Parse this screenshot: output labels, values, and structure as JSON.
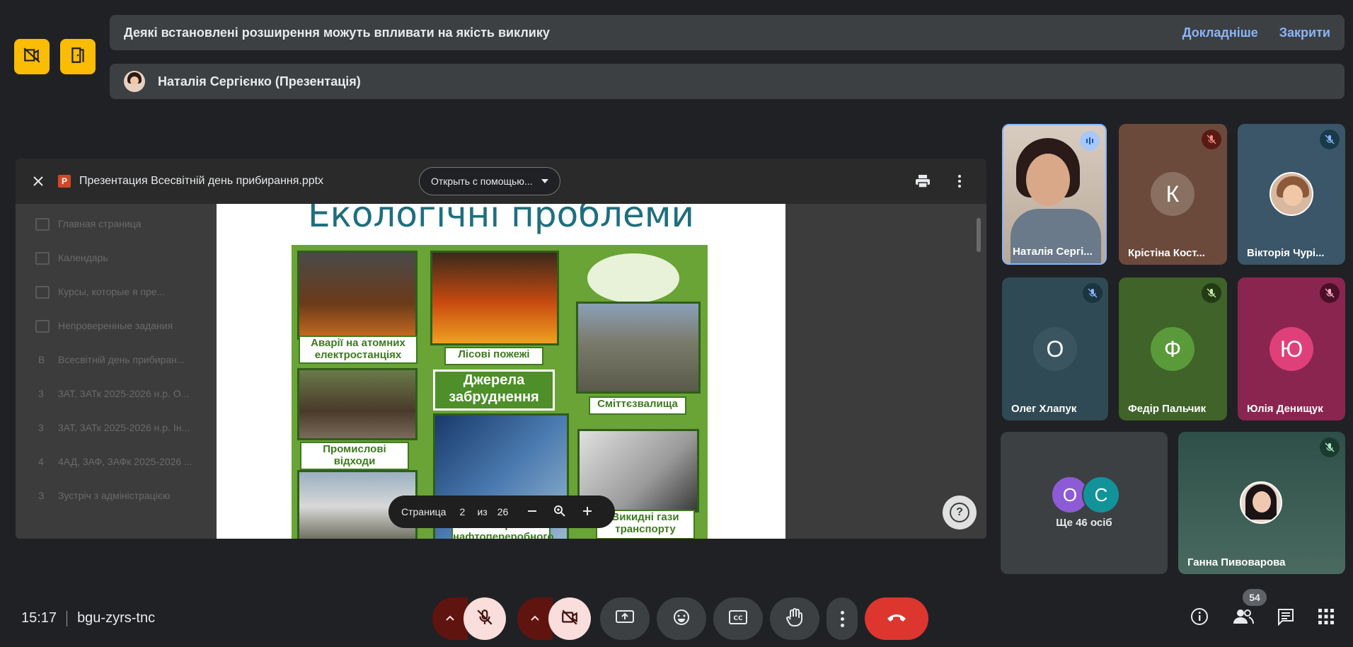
{
  "banners": {
    "warning_text": "Деякі встановлені розширення можуть впливати на якість виклику",
    "more_link": "Докладніше",
    "close_link": "Закрити",
    "presenter_text": "Наталія Сергієнко (Презентація)"
  },
  "viewer": {
    "file_name": "Презентация Всесвітній день прибирання.pptx",
    "open_with": "Открыть с помощью...",
    "page_label": "Страница",
    "page_current": "2",
    "page_of": "из",
    "page_total": "26",
    "ghost_items": [
      "Главная страница",
      "Календарь",
      "Курсы, которые я пре...",
      "Непроверенные задания",
      "Всесвітній день прибиран...",
      "3АТ, 3АТк 2025-2026 н.р. О...",
      "3АТ, 3АТк 2025-2026 н.р. Ін...",
      "4АД, 3АФ, 3АФк 2025-2026 ...",
      "Зустріч з адміністрацією"
    ],
    "ghost_numbers": [
      "В",
      "3",
      "3",
      "4",
      "З"
    ]
  },
  "slide": {
    "title": "Екологічні проблеми",
    "captions": {
      "nuclear": "Аварії на атомних електростанціях",
      "fires": "Лісові пожежі",
      "sources": "Джерела забруднення",
      "landfill": "Сміттєзвалища",
      "industrial": "Промислові відходи",
      "oil": "Аварії нафтопереробного",
      "exhaust": "Викидні гази транспорту"
    }
  },
  "participants": [
    {
      "name": "Наталія Сергі...",
      "initial": "",
      "bg": "#c9b8a8",
      "speaking": true
    },
    {
      "name": "Крістіна Кост...",
      "initial": "К",
      "bg": "#6b4a3c"
    },
    {
      "name": "Вікторія Чурі...",
      "initial": "",
      "bg": "#3a5668"
    },
    {
      "name": "Олег Хлапук",
      "initial": "О",
      "bg": "#2f4a55",
      "avatar_bg": "#3b5560"
    },
    {
      "name": "Федір Пальчик",
      "initial": "Ф",
      "bg": "#3f6328",
      "avatar_bg": "#5a9a3a"
    },
    {
      "name": "Юлія Денищук",
      "initial": "Ю",
      "bg": "#8a2550",
      "avatar_bg": "#e0407a"
    },
    {
      "name": "Ганна Пивоварова",
      "initial": "",
      "bg": "#3c5a52"
    }
  ],
  "others": {
    "label": "Ще 46 осіб",
    "initials": [
      "О",
      "С"
    ],
    "colors": [
      "#8e5bd6",
      "#12939a"
    ]
  },
  "bottom": {
    "time": "15:17",
    "meeting_code": "bgu-zyrs-tnc",
    "people_count": "54"
  }
}
